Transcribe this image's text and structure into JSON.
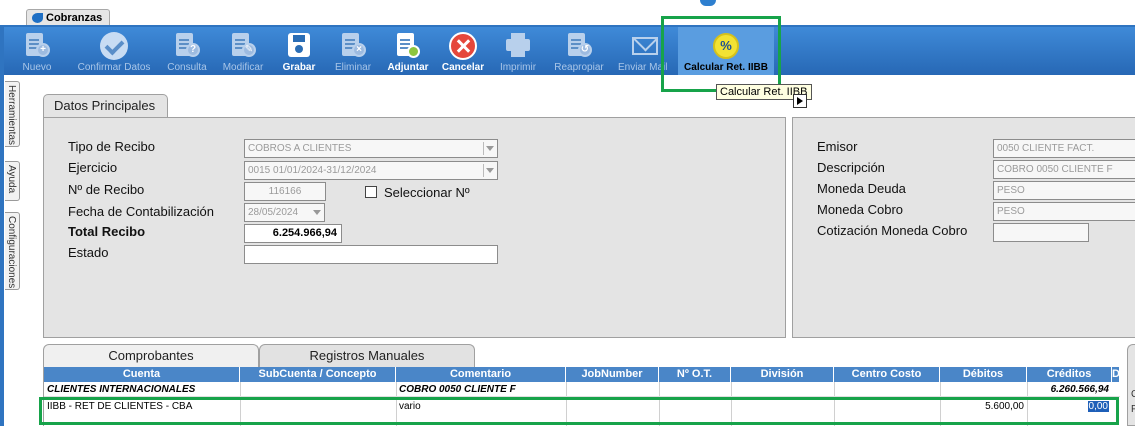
{
  "window": {
    "tab_label": "Cobranzas"
  },
  "toolbar": {
    "buttons": [
      {
        "label": "Nuevo",
        "icon": "new-document-icon",
        "enabled": false
      },
      {
        "label": "Confirmar Datos",
        "icon": "check-icon",
        "enabled": false
      },
      {
        "label": "Consulta",
        "icon": "query-document-icon",
        "enabled": false
      },
      {
        "label": "Modificar",
        "icon": "edit-document-icon",
        "enabled": false
      },
      {
        "label": "Grabar",
        "icon": "save-icon",
        "enabled": true
      },
      {
        "label": "Eliminar",
        "icon": "delete-document-icon",
        "enabled": false
      },
      {
        "label": "Adjuntar",
        "icon": "attach-document-icon",
        "enabled": true
      },
      {
        "label": "Cancelar",
        "icon": "cancel-icon",
        "enabled": true
      },
      {
        "label": "Imprimir",
        "icon": "printer-icon",
        "enabled": false
      },
      {
        "label": "Reapropiar",
        "icon": "reassign-document-icon",
        "enabled": false
      },
      {
        "label": "Enviar Mail",
        "icon": "mail-icon",
        "enabled": false
      },
      {
        "label": "Calcular Ret. IIBB",
        "icon": "percent-calc-icon",
        "enabled": true,
        "selected": true
      }
    ],
    "tooltip": "Calcular Ret. IIBB"
  },
  "side_tabs": [
    "Herramientas",
    "Ayuda",
    "Configuraciones"
  ],
  "datos_principales": {
    "title": "Datos Principales",
    "tipo_recibo": {
      "label": "Tipo de Recibo",
      "value": "COBROS A CLIENTES"
    },
    "ejercicio": {
      "label": "Ejercicio",
      "value": "0015 01/01/2024-31/12/2024"
    },
    "nro_recibo": {
      "label": "Nº de Recibo",
      "value": "116166"
    },
    "seleccionar": {
      "label": "Seleccionar Nº"
    },
    "fecha_contab": {
      "label": "Fecha de Contabilización",
      "value": "28/05/2024"
    },
    "total_recibo": {
      "label": "Total Recibo",
      "value": "6.254.966,94"
    },
    "estado": {
      "label": "Estado",
      "value": ""
    }
  },
  "right_panel": {
    "emisor": {
      "label": "Emisor",
      "value": "0050 CLIENTE FACT."
    },
    "descripcion": {
      "label": "Descripción",
      "value": "COBRO 0050 CLIENTE F"
    },
    "moneda_deuda": {
      "label": "Moneda Deuda",
      "value": "PESO"
    },
    "moneda_cobro": {
      "label": "Moneda Cobro",
      "value": "PESO"
    },
    "cotizacion": {
      "label": "Cotización Moneda Cobro",
      "value": ""
    }
  },
  "bottom_tabs": [
    "Comprobantes",
    "Registros Manuales"
  ],
  "grid": {
    "headers": [
      "Cuenta",
      "SubCuenta / Concepto",
      "Comentario",
      "JobNumber",
      "Nº O.T.",
      "División",
      "Centro Costo",
      "Débitos",
      "Créditos",
      "D"
    ],
    "rows": [
      {
        "cuenta": "CLIENTES INTERNACIONALES",
        "subcuenta": "",
        "comentario": "COBRO 0050 CLIENTE F",
        "job": "",
        "ot": "",
        "division": "",
        "centro": "",
        "debitos": "",
        "creditos": "6.260.566,94"
      },
      {
        "cuenta": "IIBB - RET DE CLIENTES - CBA",
        "subcuenta": "",
        "comentario": "vario",
        "job": "",
        "ot": "",
        "division": "",
        "centro": "",
        "debitos": "5.600,00",
        "creditos": "0,00"
      }
    ]
  },
  "right_stub_letters": [
    "C",
    "P"
  ]
}
